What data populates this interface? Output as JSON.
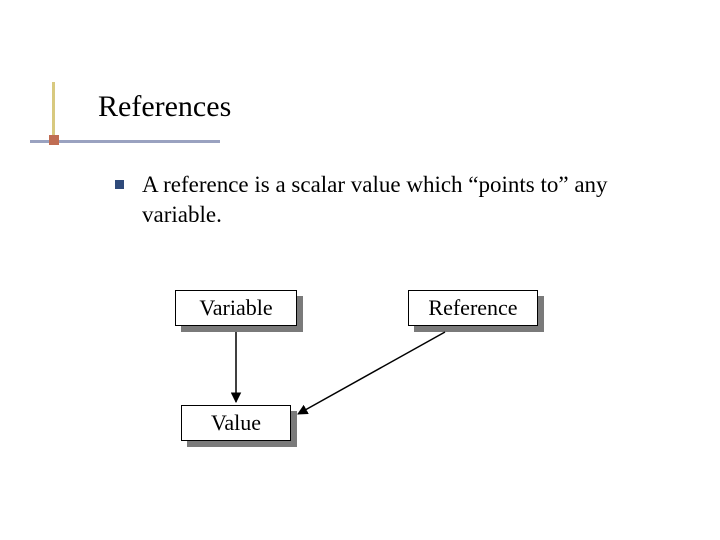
{
  "title": "References",
  "bullet": "A reference is a scalar value which “points to” any variable.",
  "boxes": {
    "variable": "Variable",
    "reference": "Reference",
    "value": "Value"
  }
}
